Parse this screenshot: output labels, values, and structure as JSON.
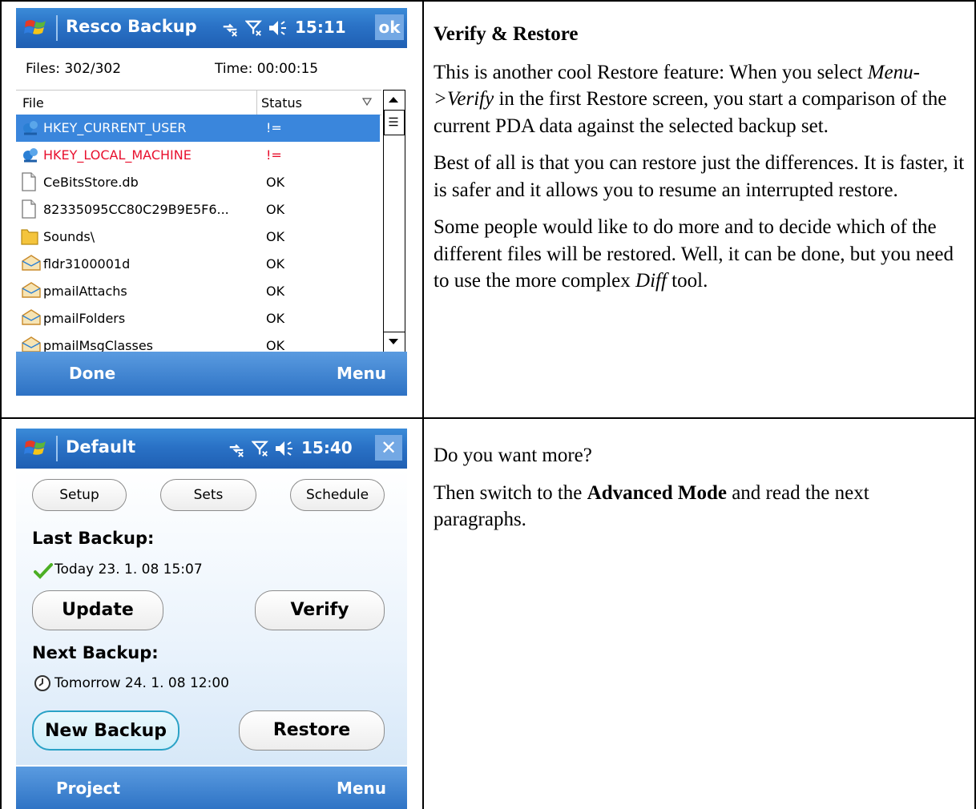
{
  "screen1": {
    "title": "Resco Backup",
    "time": "15:11",
    "ok_label": "ok",
    "files_info": "Files: 302/302",
    "time_info": "Time: 00:00:15",
    "col_file": "File",
    "col_status": "Status",
    "rows": [
      {
        "name": "HKEY_CURRENT_USER",
        "status": "!=",
        "icon": "registry-icon"
      },
      {
        "name": "HKEY_LOCAL_MACHINE",
        "status": "!=",
        "icon": "registry-icon"
      },
      {
        "name": "CeBitsStore.db",
        "status": "OK",
        "icon": "file-icon"
      },
      {
        "name": "82335095CC80C29B9E5F6...",
        "status": "OK",
        "icon": "file-icon"
      },
      {
        "name": "Sounds\\",
        "status": "OK",
        "icon": "folder-icon"
      },
      {
        "name": "fldr3100001d",
        "status": "OK",
        "icon": "mail-icon"
      },
      {
        "name": "pmailAttachs",
        "status": "OK",
        "icon": "mail-icon"
      },
      {
        "name": "pmailFolders",
        "status": "OK",
        "icon": "mail-icon"
      },
      {
        "name": "pmailMsgClasses",
        "status": "OK",
        "icon": "mail-icon"
      }
    ],
    "soft_left": "Done",
    "soft_right": "Menu"
  },
  "screen2": {
    "title": "Default",
    "time": "15:40",
    "close_label": "✕",
    "setup_label": "Setup",
    "sets_label": "Sets",
    "schedule_label": "Schedule",
    "last_backup_label": "Last Backup:",
    "last_backup_value": "Today 23. 1. 08 15:07",
    "update_label": "Update",
    "verify_label": "Verify",
    "next_backup_label": "Next Backup:",
    "next_backup_value": "Tomorrow 24. 1. 08 12:00",
    "new_backup_label": "New Backup",
    "restore_label": "Restore",
    "soft_left": "Project",
    "soft_right": "Menu"
  },
  "text1": {
    "heading": "Verify & Restore",
    "p1_a": "This is another cool Restore feature: When you select ",
    "p1_em": "Menu->Verify",
    "p1_b": " in the first Restore screen, you start a comparison of the current PDA data against the selected backup set.",
    "p2": "Best of all is that you can restore just the differences. It is faster, it is safer and it allows you to resume an interrupted restore.",
    "p3_a": "Some people would like to do more and to decide which of the different files will be restored. Well, it can be done, but you need to use the more complex ",
    "p3_em": "Diff",
    "p3_b": " tool."
  },
  "text2": {
    "p1": "Do you want more?",
    "p2_a": "Then switch to the ",
    "p2_bold": "Advanced Mode",
    "p2_b": " and read the next paragraphs."
  }
}
